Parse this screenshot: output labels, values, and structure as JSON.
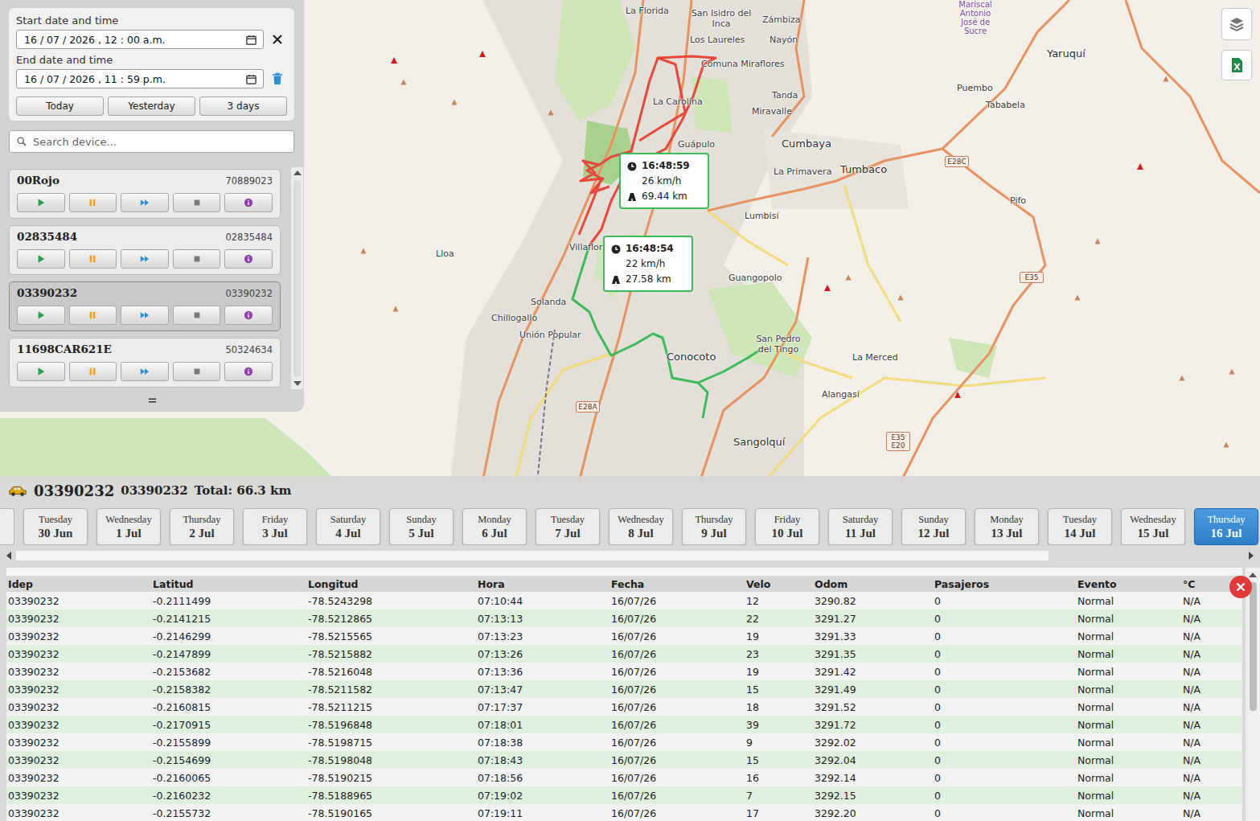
{
  "filters": {
    "start_label": "Start date and time",
    "start_value": "16 / 07 / 2026 , 12 : 00 a.m.",
    "end_label": "End date and time",
    "end_value": "16 / 07 / 2026 , 11 : 59 p.m.",
    "quick_buttons": [
      "Today",
      "Yesterday",
      "3 days"
    ]
  },
  "search": {
    "placeholder": "Search device..."
  },
  "device_controls": [
    {
      "kind": "play",
      "color": "#2e9e4f"
    },
    {
      "kind": "pause",
      "color": "#f0a020"
    },
    {
      "kind": "forward",
      "color": "#2b8fd6"
    },
    {
      "kind": "stop",
      "color": "#7a7a7a"
    },
    {
      "kind": "info",
      "color": "#8e44ad"
    }
  ],
  "devices": [
    {
      "name": "00Rojo",
      "id": "70889023",
      "selected": false
    },
    {
      "name": "02835484",
      "id": "02835484",
      "selected": false
    },
    {
      "name": "03390232",
      "id": "03390232",
      "selected": true
    },
    {
      "name": "11698CAR621E",
      "id": "50324634",
      "selected": false
    }
  ],
  "map": {
    "labels": [
      {
        "text": "La Florida",
        "kind": "place"
      },
      {
        "text": "San Isidro del Inca",
        "kind": "place"
      },
      {
        "text": "Zámbiza",
        "kind": "place"
      },
      {
        "text": "Mariscal Antonio José de Sucre",
        "kind": "airport"
      },
      {
        "text": "Yaruquí",
        "kind": "town"
      },
      {
        "text": "Los Laureles",
        "kind": "place"
      },
      {
        "text": "Nayón",
        "kind": "place"
      },
      {
        "text": "Comuna Miraflores",
        "kind": "place"
      },
      {
        "text": "Puembo",
        "kind": "place"
      },
      {
        "text": "Tababela",
        "kind": "place"
      },
      {
        "text": "La Carolina",
        "kind": "place"
      },
      {
        "text": "Tanda",
        "kind": "place"
      },
      {
        "text": "Miravalle",
        "kind": "place"
      },
      {
        "text": "Cumbaya",
        "kind": "town"
      },
      {
        "text": "Guápulo",
        "kind": "place"
      },
      {
        "text": "Tumbaco",
        "kind": "town"
      },
      {
        "text": "La Primavera",
        "kind": "place"
      },
      {
        "text": "Pifo",
        "kind": "place"
      },
      {
        "text": "Lumbisí",
        "kind": "place"
      },
      {
        "text": "Lloa",
        "kind": "place"
      },
      {
        "text": "Villaflor",
        "kind": "place"
      },
      {
        "text": "Guangopolo",
        "kind": "place"
      },
      {
        "text": "Solanda",
        "kind": "place"
      },
      {
        "text": "Chillogallo",
        "kind": "place"
      },
      {
        "text": "Unión Popular",
        "kind": "place"
      },
      {
        "text": "Conocoto",
        "kind": "town"
      },
      {
        "text": "San Pedro del Tingo",
        "kind": "place"
      },
      {
        "text": "La Merced",
        "kind": "place"
      },
      {
        "text": "Alangasí",
        "kind": "place"
      },
      {
        "text": "Sangolquí",
        "kind": "town"
      }
    ],
    "shields": [
      "E28C",
      "E35",
      "E28A",
      "E35 E20"
    ],
    "routes": [
      {
        "color": "#e8473a"
      },
      {
        "color": "#3dbb5b"
      }
    ],
    "tooltips": [
      {
        "time": "16:48:59",
        "speed": "26 km/h",
        "distance": "69.44 km"
      },
      {
        "time": "16:48:54",
        "speed": "22 km/h",
        "distance": "27.58 km"
      }
    ]
  },
  "track": {
    "vehicle": "03390232",
    "id": "03390232",
    "total": "Total: 66.3 km",
    "days": [
      {
        "weekday": "Tuesday",
        "date": "30 Jun",
        "selected": false
      },
      {
        "weekday": "Wednesday",
        "date": "1 Jul",
        "selected": false
      },
      {
        "weekday": "Thursday",
        "date": "2 Jul",
        "selected": false
      },
      {
        "weekday": "Friday",
        "date": "3 Jul",
        "selected": false
      },
      {
        "weekday": "Saturday",
        "date": "4 Jul",
        "selected": false
      },
      {
        "weekday": "Sunday",
        "date": "5 Jul",
        "selected": false
      },
      {
        "weekday": "Monday",
        "date": "6 Jul",
        "selected": false
      },
      {
        "weekday": "Tuesday",
        "date": "7 Jul",
        "selected": false
      },
      {
        "weekday": "Wednesday",
        "date": "8 Jul",
        "selected": false
      },
      {
        "weekday": "Thursday",
        "date": "9 Jul",
        "selected": false
      },
      {
        "weekday": "Friday",
        "date": "10 Jul",
        "selected": false
      },
      {
        "weekday": "Saturday",
        "date": "11 Jul",
        "selected": false
      },
      {
        "weekday": "Sunday",
        "date": "12 Jul",
        "selected": false
      },
      {
        "weekday": "Monday",
        "date": "13 Jul",
        "selected": false
      },
      {
        "weekday": "Tuesday",
        "date": "14 Jul",
        "selected": false
      },
      {
        "weekday": "Wednesday",
        "date": "15 Jul",
        "selected": false
      },
      {
        "weekday": "Thursday",
        "date": "16 Jul",
        "selected": true
      }
    ]
  },
  "table": {
    "columns": [
      "Idep",
      "Latitud",
      "Longitud",
      "Hora",
      "Fecha",
      "Velo",
      "Odom",
      "Pasajeros",
      "Evento",
      "°C"
    ],
    "rows": [
      [
        "03390232",
        "-0.2111499",
        "-78.5243298",
        "07:10:44",
        "16/07/26",
        "12",
        "3290.82",
        "0",
        "Normal",
        "N/A"
      ],
      [
        "03390232",
        "-0.2141215",
        "-78.5212865",
        "07:13:13",
        "16/07/26",
        "22",
        "3291.27",
        "0",
        "Normal",
        "N/A"
      ],
      [
        "03390232",
        "-0.2146299",
        "-78.5215565",
        "07:13:23",
        "16/07/26",
        "19",
        "3291.33",
        "0",
        "Normal",
        "N/A"
      ],
      [
        "03390232",
        "-0.2147899",
        "-78.5215882",
        "07:13:26",
        "16/07/26",
        "23",
        "3291.35",
        "0",
        "Normal",
        "N/A"
      ],
      [
        "03390232",
        "-0.2153682",
        "-78.5216048",
        "07:13:36",
        "16/07/26",
        "19",
        "3291.42",
        "0",
        "Normal",
        "N/A"
      ],
      [
        "03390232",
        "-0.2158382",
        "-78.5211582",
        "07:13:47",
        "16/07/26",
        "15",
        "3291.49",
        "0",
        "Normal",
        "N/A"
      ],
      [
        "03390232",
        "-0.2160815",
        "-78.5211215",
        "07:17:37",
        "16/07/26",
        "18",
        "3291.52",
        "0",
        "Normal",
        "N/A"
      ],
      [
        "03390232",
        "-0.2170915",
        "-78.5196848",
        "07:18:01",
        "16/07/26",
        "39",
        "3291.72",
        "0",
        "Normal",
        "N/A"
      ],
      [
        "03390232",
        "-0.2155899",
        "-78.5198715",
        "07:18:38",
        "16/07/26",
        "9",
        "3292.02",
        "0",
        "Normal",
        "N/A"
      ],
      [
        "03390232",
        "-0.2154699",
        "-78.5198048",
        "07:18:43",
        "16/07/26",
        "15",
        "3292.04",
        "0",
        "Normal",
        "N/A"
      ],
      [
        "03390232",
        "-0.2160065",
        "-78.5190215",
        "07:18:56",
        "16/07/26",
        "16",
        "3292.14",
        "0",
        "Normal",
        "N/A"
      ],
      [
        "03390232",
        "-0.2160232",
        "-78.5188965",
        "07:19:02",
        "16/07/26",
        "7",
        "3292.15",
        "0",
        "Normal",
        "N/A"
      ],
      [
        "03390232",
        "-0.2155732",
        "-78.5190165",
        "07:19:11",
        "16/07/26",
        "17",
        "3292.20",
        "0",
        "Normal",
        "N/A"
      ]
    ]
  }
}
